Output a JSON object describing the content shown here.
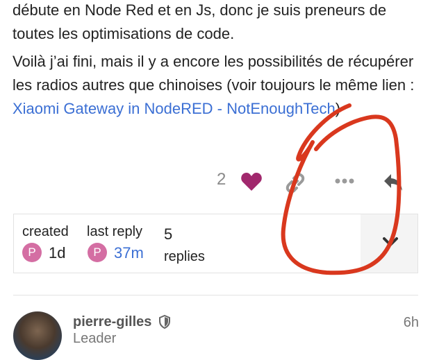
{
  "post": {
    "text_top": "débute en Node Red et en Js, donc je suis preneurs de toutes les optimisations de code.",
    "text_main": "Voilà j’ai fini, mais il y a encore les possibilités de récupérer les radios autres que chinoises (voir toujours le même lien : ",
    "link_text": "Xiaomi Gateway in NodeRED - NotEnoughTech",
    "text_end": ")"
  },
  "actions": {
    "like_count": "2",
    "icons": [
      "heart-icon",
      "link-icon",
      "more-icon",
      "reply-icon"
    ]
  },
  "summary": {
    "created_label": "created",
    "created_avatar": "P",
    "created_value": "1d",
    "last_reply_label": "last reply",
    "last_reply_avatar": "P",
    "last_reply_value": "37m",
    "replies_count": "5",
    "replies_label": "replies"
  },
  "reply": {
    "username": "pierre-gilles",
    "user_title": "Leader",
    "age": "6h"
  },
  "colors": {
    "accent_link": "#3b6fd4",
    "heart": "#a1286d",
    "avatar_pink": "#d46ea3",
    "annotation_red": "#d9381e"
  }
}
